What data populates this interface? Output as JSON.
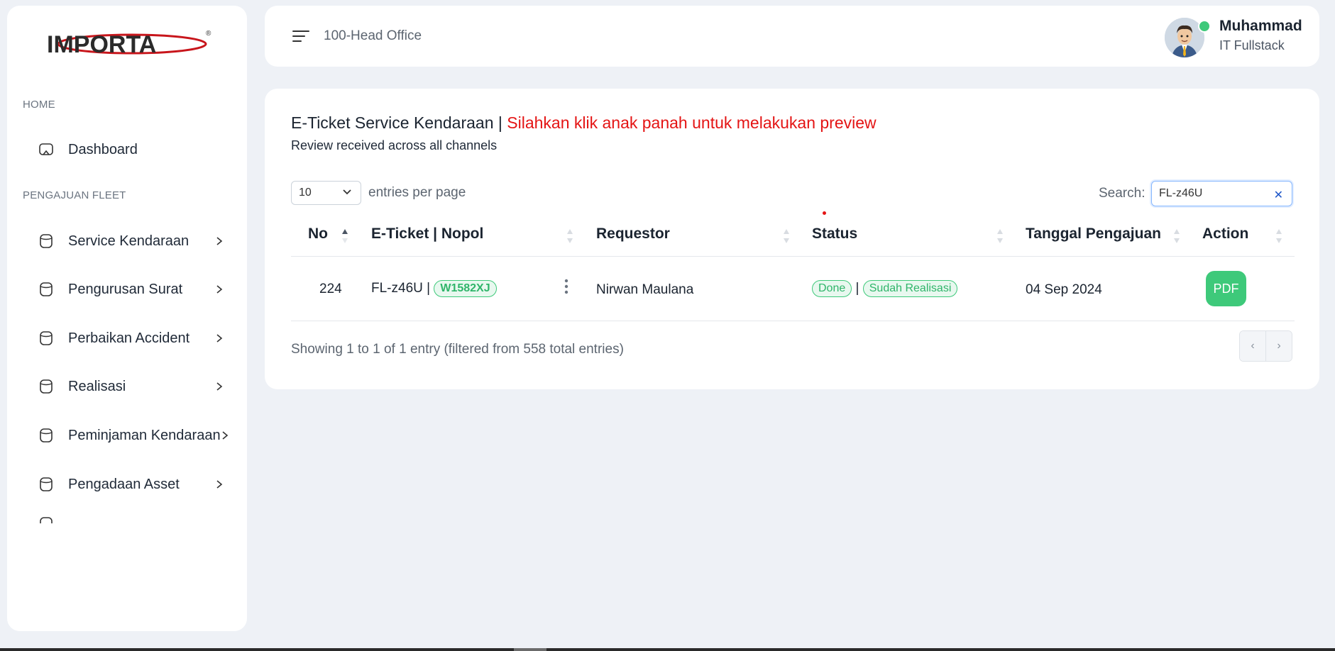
{
  "sidebar": {
    "logo_text": "IMPORTA",
    "logo_reg": "®",
    "section_home": "HOME",
    "dashboard": {
      "label": "Dashboard",
      "icon": "monitor-icon"
    },
    "section_fleet": "PENGAJUAN FLEET",
    "items": [
      {
        "label": "Service Kendaraan",
        "icon": "cylinder-icon"
      },
      {
        "label": "Pengurusan Surat",
        "icon": "cylinder-icon"
      },
      {
        "label": "Perbaikan Accident",
        "icon": "cylinder-icon"
      },
      {
        "label": "Realisasi",
        "icon": "cylinder-icon"
      },
      {
        "label": "Peminjaman Kendaraan",
        "icon": "cylinder-icon"
      },
      {
        "label": "Pengadaan Asset",
        "icon": "cylinder-icon"
      }
    ]
  },
  "header": {
    "office": "100-Head Office",
    "user_name": "Muhammad",
    "user_role": "IT Fullstack",
    "online_color": "#3ec97a"
  },
  "card": {
    "title_main": "E-Ticket Service Kendaraan | ",
    "title_highlight": "Silahkan klik anak panah untuk melakukan preview",
    "subtitle": "Review received across all channels",
    "per_page_value": "10",
    "per_page_label": "entries per page",
    "search_label": "Search:",
    "search_value": "FL-z46U",
    "columns": [
      "No",
      "E-Ticket | Nopol",
      "Requestor",
      "Status",
      "Tanggal Pengajuan",
      "Action"
    ],
    "rows": [
      {
        "no": "224",
        "ticket": "FL-z46U",
        "separator": "|",
        "nopol": "W1582XJ",
        "requestor": "Nirwan Maulana",
        "status": "Done",
        "status_sep": "|",
        "realisasi": "Sudah Realisasi",
        "tanggal": "04 Sep 2024",
        "action": "PDF"
      }
    ],
    "info": "Showing 1 to 1 of 1 entry (filtered from 558 total entries)",
    "pager_prev": "‹",
    "pager_next": "›"
  },
  "colors": {
    "accent_green": "#3ec97a",
    "highlight_red": "#e41414",
    "logo_red": "#c8151b"
  }
}
